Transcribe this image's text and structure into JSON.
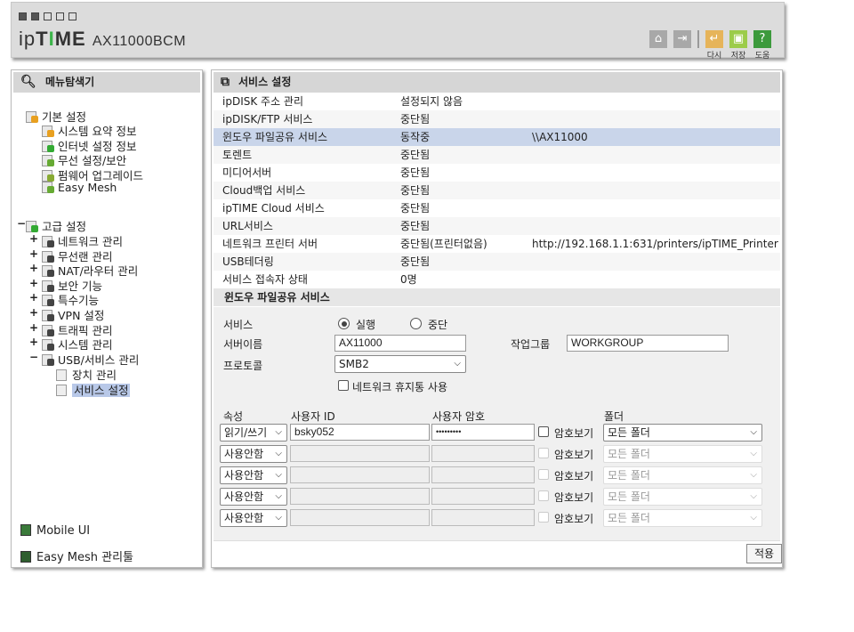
{
  "header": {
    "brand": "ipTIME",
    "model": "AX11000BCM",
    "buttons": [
      {
        "icon": "home-icon"
      },
      {
        "icon": "logout-icon"
      },
      {
        "icon": "restart-icon",
        "label": "다시"
      },
      {
        "icon": "save-icon",
        "label": "저장"
      },
      {
        "icon": "help-icon",
        "label": "도움"
      }
    ]
  },
  "sidebar": {
    "title": "메뉴탐색기",
    "basic": {
      "label": "기본 설정",
      "items": [
        "시스템 요약 정보",
        "인터넷 설정 정보",
        "무선 설정/보안",
        "펌웨어 업그레이드",
        "Easy Mesh"
      ]
    },
    "advanced": {
      "label": "고급 설정",
      "items": [
        "네트워크 관리",
        "무선랜 관리",
        "NAT/라우터 관리",
        "보안 기능",
        "특수기능",
        "VPN 설정",
        "트래픽 관리",
        "시스템 관리",
        "USB/서비스 관리"
      ],
      "usb_children": [
        "장치 관리",
        "서비스 설정"
      ]
    },
    "mobile_ui": "Mobile UI",
    "easymesh_tool": "Easy Mesh 관리툴"
  },
  "main": {
    "title": "서비스 설정",
    "services": [
      {
        "name": "ipDISK 주소 관리",
        "status": "설정되지 않음",
        "extra": ""
      },
      {
        "name": "ipDISK/FTP 서비스",
        "status": "중단됨",
        "extra": ""
      },
      {
        "name": "윈도우 파일공유 서비스",
        "status": "동작중",
        "extra": "\\\\AX11000"
      },
      {
        "name": "토렌트",
        "status": "중단됨",
        "extra": ""
      },
      {
        "name": "미디어서버",
        "status": "중단됨",
        "extra": ""
      },
      {
        "name": "Cloud백업 서비스",
        "status": "중단됨",
        "extra": ""
      },
      {
        "name": "ipTIME Cloud 서비스",
        "status": "중단됨",
        "extra": ""
      },
      {
        "name": "URL서비스",
        "status": "중단됨",
        "extra": ""
      },
      {
        "name": "네트워크 프린터 서버",
        "status": "중단됨(프린터없음)",
        "extra": "http://192.168.1.1:631/printers/ipTIME_Printer"
      },
      {
        "name": "USB테더링",
        "status": "중단됨",
        "extra": ""
      },
      {
        "name": "서비스 접속자 상태",
        "status": "0명",
        "extra": ""
      }
    ],
    "section_title": "윈도우 파일공유 서비스",
    "form": {
      "service_label": "서비스",
      "run": "실행",
      "stop": "중단",
      "server_name_label": "서버이름",
      "server_name": "AX11000",
      "workgroup_label": "작업그룹",
      "workgroup": "WORKGROUP",
      "protocol_label": "프로토콜",
      "protocol": "SMB2",
      "recycle_label": "네트워크 휴지통 사용"
    },
    "users_header": {
      "attr": "속성",
      "id": "사용자 ID",
      "pw": "사용자 암호",
      "folder": "폴더"
    },
    "users": [
      {
        "attr": "읽기/쓰기",
        "id": "bsky052",
        "pw": "•••••••••",
        "show": "암호보기",
        "folder": "모든 폴더",
        "enabled": true
      },
      {
        "attr": "사용안함",
        "id": "",
        "pw": "",
        "show": "암호보기",
        "folder": "모든 폴더",
        "enabled": false
      },
      {
        "attr": "사용안함",
        "id": "",
        "pw": "",
        "show": "암호보기",
        "folder": "모든 폴더",
        "enabled": false
      },
      {
        "attr": "사용안함",
        "id": "",
        "pw": "",
        "show": "암호보기",
        "folder": "모든 폴더",
        "enabled": false
      },
      {
        "attr": "사용안함",
        "id": "",
        "pw": "",
        "show": "암호보기",
        "folder": "모든 폴더",
        "enabled": false
      }
    ],
    "apply": "적용"
  }
}
